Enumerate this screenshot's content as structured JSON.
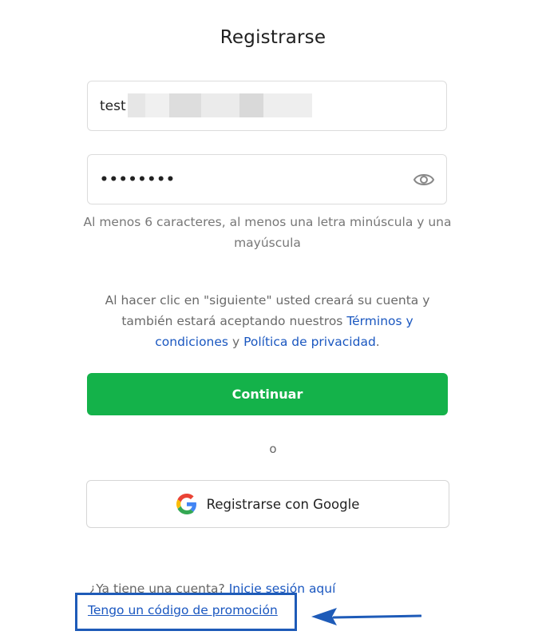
{
  "page": {
    "title": "Registrarse"
  },
  "email_field": {
    "value": "test"
  },
  "password_field": {
    "masked_value": "••••••••",
    "toggle_icon": "eye-icon"
  },
  "password_hint": "Al menos 6 caracteres, al menos una letra minúscula y una mayúscula",
  "terms": {
    "prefix": "Al hacer clic en \"siguiente\" usted creará su cuenta y también estará aceptando nuestros",
    "terms_link": "Términos y condiciones",
    "connector": "y",
    "privacy_link": "Política de privacidad",
    "suffix": "."
  },
  "continue_button": {
    "label": "Continuar",
    "color": "#14b24a"
  },
  "separator": "o",
  "google_button": {
    "label": "Registrarse con Google",
    "icon": "google-icon"
  },
  "login": {
    "question": "¿Ya tiene una cuenta?",
    "link": "Inicie sesión aquí"
  },
  "promo": {
    "link": "Tengo un código de promoción",
    "highlight_color": "#1e5bb8"
  },
  "annotation": {
    "arrow_icon": "arrow-left-icon"
  }
}
